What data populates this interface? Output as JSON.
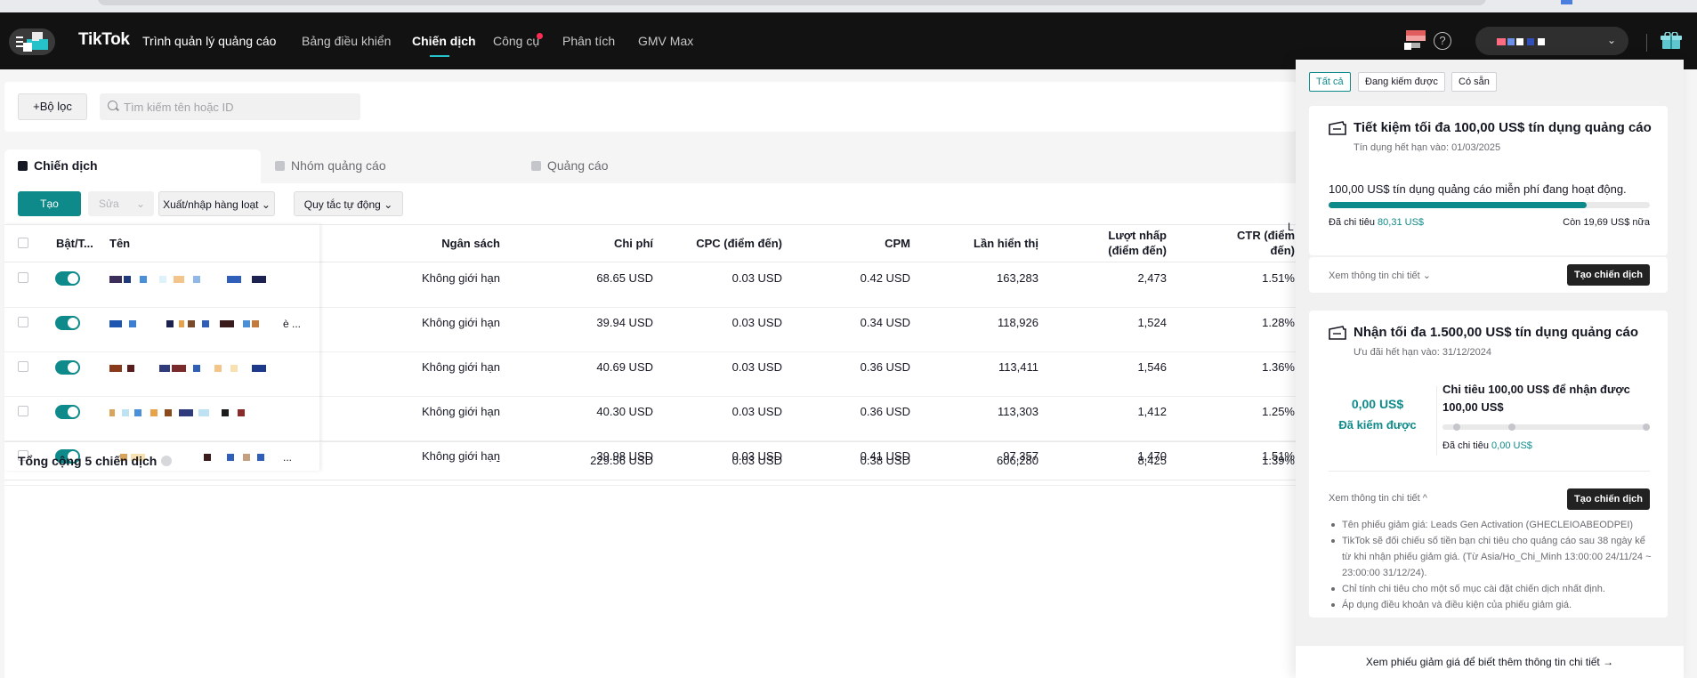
{
  "colors": {
    "nav_bg": "#121212",
    "accent": "#0f8a8a",
    "accent_bright": "#25c2c9",
    "danger": "#fe2c55"
  },
  "header": {
    "logo_text": "TikTok",
    "logo_subtitle": "Trình quản lý quảng cáo",
    "nav": [
      {
        "label": "Bảng điều khiển"
      },
      {
        "label": "Chiến dịch"
      },
      {
        "label": "Công cụ"
      },
      {
        "label": "Phân tích"
      },
      {
        "label": "GMV Max"
      }
    ],
    "active_nav": "Chiến dịch",
    "help_glyph": "?",
    "chevron": "⌄",
    "icons": [
      "menu-icon",
      "tiktok-logo-icon",
      "flag-icon",
      "help-icon",
      "gift-icon"
    ]
  },
  "filter": {
    "filter_button": "+Bộ lọc",
    "search_placeholder": "Tìm kiếm tên hoặc ID"
  },
  "tabs": [
    {
      "label": "Chiến dịch"
    },
    {
      "label": "Nhóm quảng cáo"
    },
    {
      "label": "Quảng cáo"
    }
  ],
  "toolbar": {
    "create": "Tạo",
    "edit": "Sửa",
    "bulk": "Xuất/nhập hàng loạt",
    "rules": "Quy tắc tự động"
  },
  "table": {
    "headers": {
      "toggle": "Bật/T...",
      "name": "Tên",
      "budget": "Ngân sách",
      "cost": "Chi phí",
      "cpc": "CPC (điểm đến)",
      "cpm": "CPM",
      "impressions": "Lần hiển thị",
      "clicks": "Lượt nhấp (điểm đến)",
      "ctr": "CTR (điểm đến)",
      "clipped": "L"
    },
    "rows": [
      {
        "name_suffix": "",
        "budget": "Không giới hạn",
        "cost": "68.65 USD",
        "cpc": "0.03 USD",
        "cpm": "0.42 USD",
        "impressions": "163,283",
        "clicks": "2,473",
        "ctr": "1.51%",
        "on": true
      },
      {
        "name_suffix": "è ...",
        "budget": "Không giới hạn",
        "cost": "39.94 USD",
        "cpc": "0.03 USD",
        "cpm": "0.34 USD",
        "impressions": "118,926",
        "clicks": "1,524",
        "ctr": "1.28%",
        "on": true
      },
      {
        "name_suffix": "",
        "budget": "Không giới hạn",
        "cost": "40.69 USD",
        "cpc": "0.03 USD",
        "cpm": "0.36 USD",
        "impressions": "113,411",
        "clicks": "1,546",
        "ctr": "1.36%",
        "on": true
      },
      {
        "name_suffix": "",
        "budget": "Không giới hạn",
        "cost": "40.30 USD",
        "cpc": "0.03 USD",
        "cpm": "0.36 USD",
        "impressions": "113,303",
        "clicks": "1,412",
        "ctr": "1.25%",
        "on": true
      },
      {
        "name_suffix": "...",
        "budget": "Không giới hạn",
        "cost": "39.98 USD",
        "cpc": "0.03 USD",
        "cpm": "0.41 USD",
        "impressions": "97,357",
        "clicks": "1,470",
        "ctr": "1.51%",
        "on": true
      }
    ],
    "total": {
      "label": "Tổng cộng 5 chiến dịch",
      "budget": "-",
      "cost": "229.56 USD",
      "cpc": "0.03 USD",
      "cpm": "0.38 USD",
      "impressions": "606,280",
      "clicks": "8,425",
      "ctr": "1.39%"
    }
  },
  "drawer": {
    "filter_chips": [
      "Tất cả",
      "Đang kiếm được",
      "Có sẵn"
    ],
    "card1": {
      "title": "Tiết kiệm tối đa 100,00 US$ tín dụng quảng cáo",
      "expiry": "Tín dụng hết hạn vào: 01/03/2025",
      "status": "100,00 US$ tín dụng quảng cáo miễn phí đang hoạt động.",
      "progress_fraction": 0.803,
      "spent_label": "Đã chi tiêu",
      "spent_value": "80,31 US$",
      "remaining": "Còn 19,69 US$ nữa",
      "details_link": "Xem thông tin chi tiết ⌄",
      "create_button": "Tạo chiến dịch"
    },
    "card2": {
      "title": "Nhận tối đa 1.500,00 US$ tín dụng quảng cáo",
      "expiry": "Ưu đãi hết hạn vào: 31/12/2024",
      "earned_amount": "0,00 US$",
      "earned_label": "Đã kiếm được",
      "goal": "Chi tiêu 100,00 US$ để nhận được 100,00 US$",
      "progress_fraction": 0.0,
      "spent_label": "Đã chi tiêu",
      "spent_value": "0,00 US$",
      "details_link": "Xem thông tin chi tiết ^",
      "create_button": "Tạo chiến dịch",
      "bullets": [
        "Tên phiếu giảm giá: Leads Gen Activation (GHECLEIOABEODPEI)",
        "TikTok sẽ đối chiếu số tiền bạn chi tiêu cho quảng cáo sau 38 ngày kể từ khi nhận phiếu giảm giá. (Từ Asia/Ho_Chi_Minh 13:00:00 24/11/24 ~ 23:00:00 31/12/24).",
        "Chỉ tính chi tiêu cho một số mục cài đặt chiến dịch nhất định.",
        "Áp dụng điều khoản và điều kiện của phiếu giảm giá."
      ]
    },
    "footer_link": "Xem phiếu giảm giá để biết thêm thông tin chi tiết →"
  }
}
